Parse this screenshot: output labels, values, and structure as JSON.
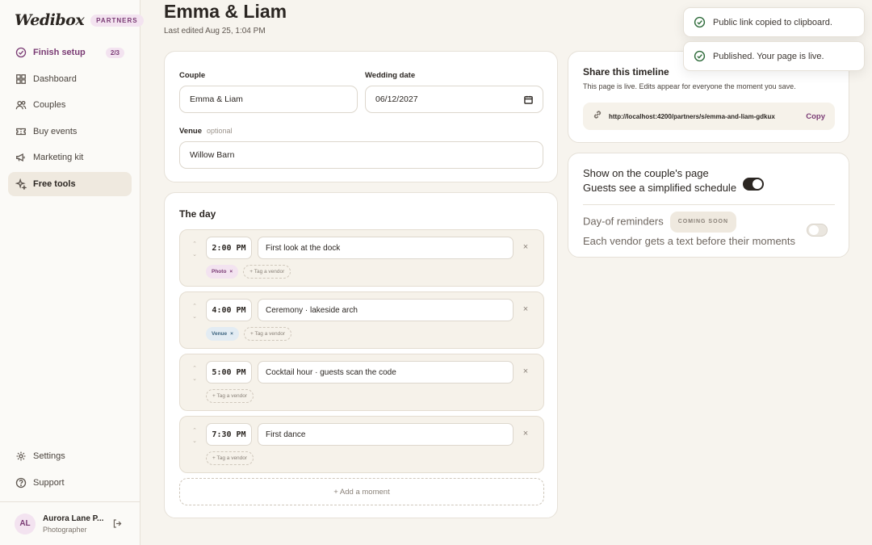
{
  "brand": {
    "logo": "Wedibox",
    "badge": "PARTNERS"
  },
  "sidebar": {
    "setup": {
      "label": "Finish setup",
      "count": "2/3"
    },
    "items": [
      {
        "label": "Dashboard",
        "icon": "grid-icon"
      },
      {
        "label": "Couples",
        "icon": "users-icon"
      },
      {
        "label": "Buy events",
        "icon": "ticket-icon"
      },
      {
        "label": "Marketing kit",
        "icon": "megaphone-icon"
      },
      {
        "label": "Free tools",
        "icon": "sparkle-icon",
        "active": true
      }
    ],
    "bottom": [
      {
        "label": "Settings",
        "icon": "gear-icon"
      },
      {
        "label": "Support",
        "icon": "help-icon"
      }
    ],
    "user": {
      "initials": "AL",
      "name": "Aurora Lane P...",
      "role": "Photographer"
    }
  },
  "header": {
    "title": "Emma & Liam",
    "last_edited": "Last edited Aug 25, 1:04 PM"
  },
  "details": {
    "couple_label": "Couple",
    "couple_value": "Emma & Liam",
    "date_label": "Wedding date",
    "date_value": "06/12/2027",
    "venue_label": "Venue",
    "venue_optional": "optional",
    "venue_value": "Willow Barn"
  },
  "day": {
    "title": "The day",
    "moments": [
      {
        "time": "2:00 PM",
        "title": "First look at the dock",
        "tags": [
          "Photo"
        ]
      },
      {
        "time": "4:00 PM",
        "title": "Ceremony · lakeside arch",
        "tags": [
          "Venue"
        ]
      },
      {
        "time": "5:00 PM",
        "title": "Cocktail hour · guests scan the code",
        "tags": []
      },
      {
        "time": "7:30 PM",
        "title": "First dance",
        "tags": []
      }
    ],
    "tag_add_label": "+ Tag a vendor",
    "tag_remove": "×",
    "remove_symbol": "×",
    "add_moment": "+ Add a moment"
  },
  "share": {
    "title": "Share this timeline",
    "subtitle": "This page is live. Edits appear for everyone the moment you save.",
    "url": "http://localhost:4200/partners/s/emma-and-liam-gdkux",
    "copy": "Copy"
  },
  "settings": {
    "show_title": "Show on the couple's page",
    "show_desc": "Guests see a simplified schedule",
    "show_on": true,
    "reminders_title": "Day-of reminders",
    "reminders_badge": "COMING SOON",
    "reminders_desc": "Each vendor gets a text before their moments",
    "reminders_on": false
  },
  "toasts": [
    {
      "text": "Public link copied to clipboard."
    },
    {
      "text": "Published. Your page is live."
    }
  ],
  "colors": {
    "accent": "#7a3b74",
    "success": "#2e6b3a"
  }
}
